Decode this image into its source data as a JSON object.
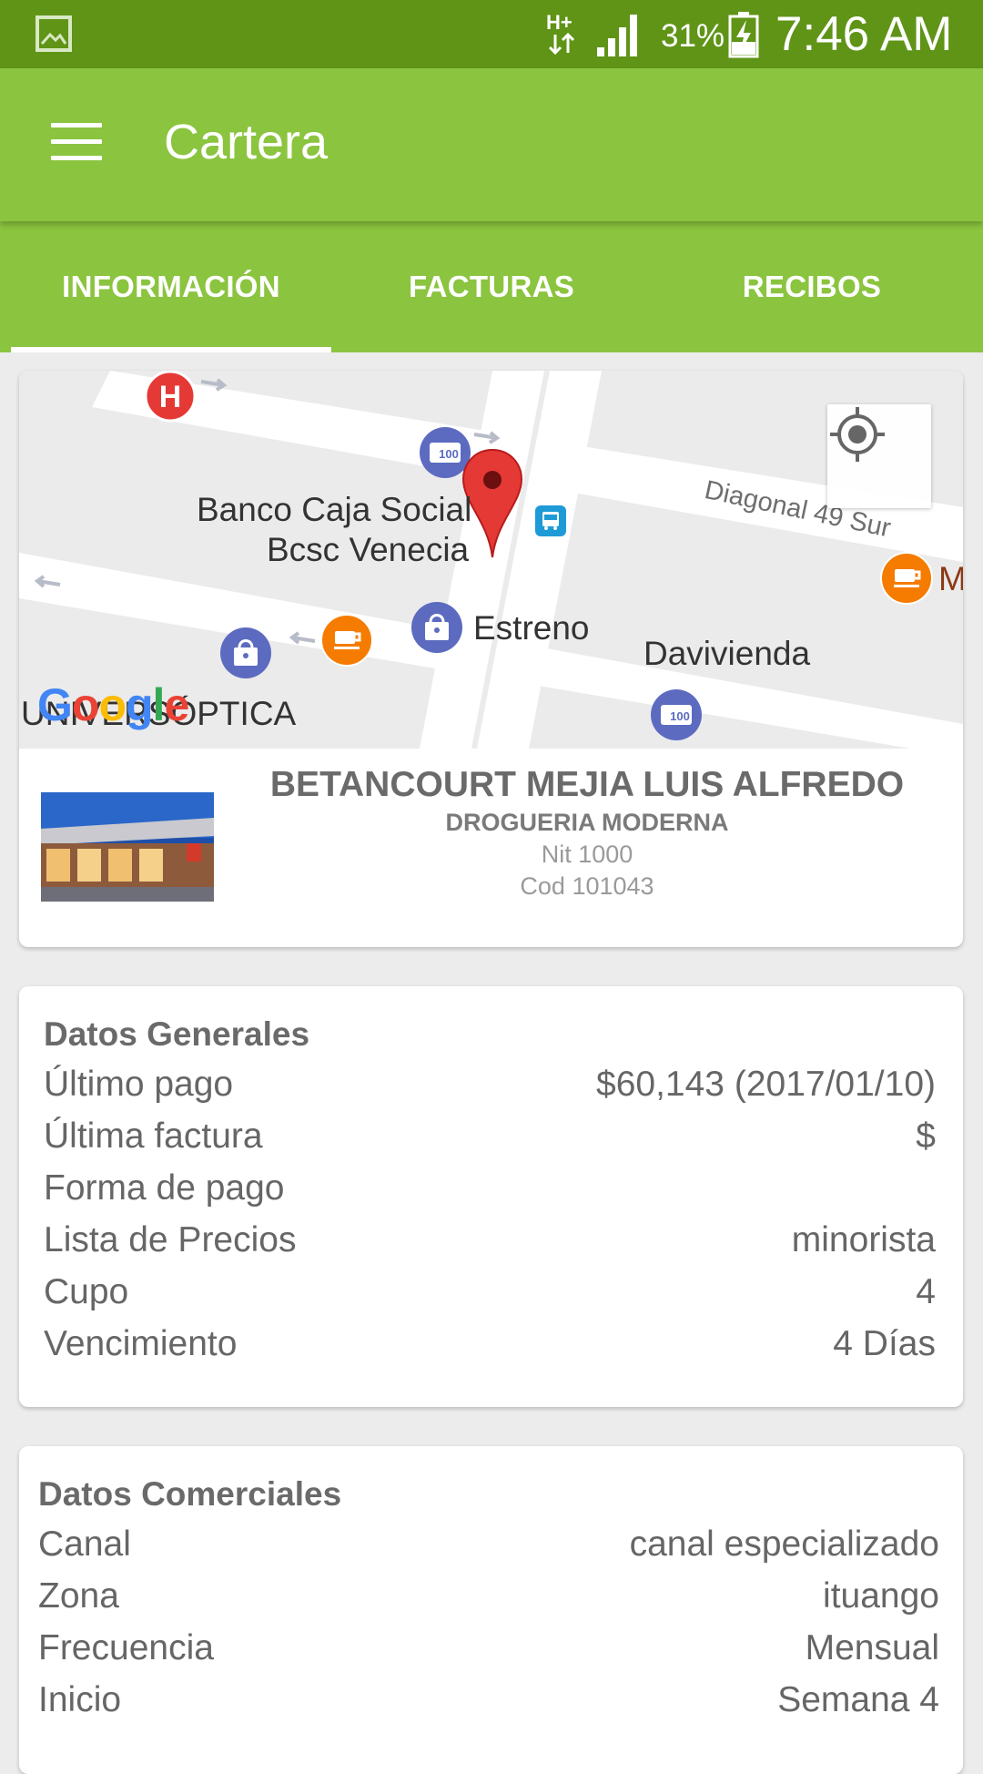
{
  "status_bar": {
    "battery_percent": "31%",
    "time": "7:46 AM",
    "network_type": "H+",
    "icons": [
      "gallery-icon",
      "network-icon",
      "signal-icon",
      "battery-charging-icon"
    ]
  },
  "app_bar": {
    "title": "Cartera",
    "menu_icon": "hamburger-menu-icon"
  },
  "tabs": [
    {
      "label": "INFORMACIÓN",
      "active": true
    },
    {
      "label": "FACTURAS",
      "active": false
    },
    {
      "label": "RECIBOS",
      "active": false
    }
  ],
  "map": {
    "labels": {
      "bank": "Banco Caja Social",
      "bank_branch": "Bcsc Venecia",
      "street": "Diagonal 49 Sur",
      "estreno": "Estreno",
      "davivienda": "Davivienda",
      "optica": "UNIVERSÓPTICA",
      "edge": "M"
    },
    "logo_text": "Google",
    "icons": [
      "hospital-icon",
      "atm-icon",
      "map-pin-icon",
      "bus-stop-icon",
      "cafe-icon",
      "shopping-bag-icon",
      "my-location-icon"
    ]
  },
  "client": {
    "name": "BETANCOURT MEJIA  LUIS ALFREDO",
    "business": "DROGUERIA MODERNA",
    "nit": "Nit 1000",
    "cod": "Cod 101043"
  },
  "general": {
    "title": "Datos Generales",
    "rows": [
      {
        "label": "Último pago",
        "value": "$60,143 (2017/01/10)"
      },
      {
        "label": "Última factura",
        "value": "$"
      },
      {
        "label": "Forma de pago",
        "value": ""
      },
      {
        "label": "Lista de Precios",
        "value": "minorista"
      },
      {
        "label": "Cupo",
        "value": "4"
      },
      {
        "label": "Vencimiento",
        "value": "4 Días"
      }
    ]
  },
  "commercial": {
    "title": "Datos Comerciales",
    "rows": [
      {
        "label": "Canal",
        "value": "canal especializado"
      },
      {
        "label": "Zona",
        "value": "ituango"
      },
      {
        "label": "Frecuencia",
        "value": "Mensual"
      },
      {
        "label": "Inicio",
        "value": "Semana 4"
      }
    ]
  },
  "colors": {
    "status_bar": "#5f9417",
    "primary": "#8bc43f",
    "background": "#ececec",
    "pin": "#e53935",
    "poi_blue": "#5c6bc0",
    "poi_orange": "#f57c00",
    "hospital": "#e53935"
  }
}
